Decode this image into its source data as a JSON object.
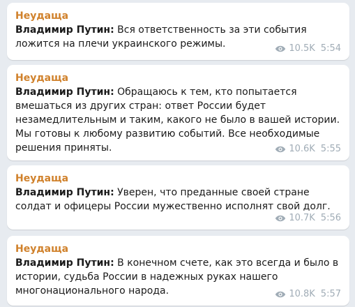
{
  "colors": {
    "background": "#e7ebf0",
    "bubble": "#ffffff",
    "sender": "#d0812b",
    "text": "#1a1a1a",
    "meta": "#a0acb6"
  },
  "messages": [
    {
      "sender": "Неудаща",
      "speaker": "Владимир Путин:",
      "text": " Вся ответственность за эти события ложится на плечи украинского режимы.",
      "views": "10.5K",
      "time": "5:54",
      "views_icon": "eye-icon"
    },
    {
      "sender": "Неудаща",
      "speaker": "Владимир Путин:",
      "text": " Обращаюсь к тем, кто попытается вмешаться из других стран: ответ России будет незамедлительным и таким, какого не было в вашей истории. Мы готовы к любому развитию событий. Все необходимые решения приняты.",
      "views": "10.6K",
      "time": "5:55",
      "views_icon": "eye-icon"
    },
    {
      "sender": "Неудаща",
      "speaker": "Владимир Путин:",
      "text": " Уверен, что преданные своей стране солдат и офицеры России мужественно исполнят свой долг.",
      "views": "10.7K",
      "time": "5:56",
      "views_icon": "eye-icon"
    },
    {
      "sender": "Неудаща",
      "speaker": "Владимир Путин:",
      "text": " В конечном счете, как это всегда и было в истории, судьба России в надежных руках нашего многонационального народа.",
      "views": "10.8K",
      "time": "5:57",
      "views_icon": "eye-icon"
    }
  ]
}
